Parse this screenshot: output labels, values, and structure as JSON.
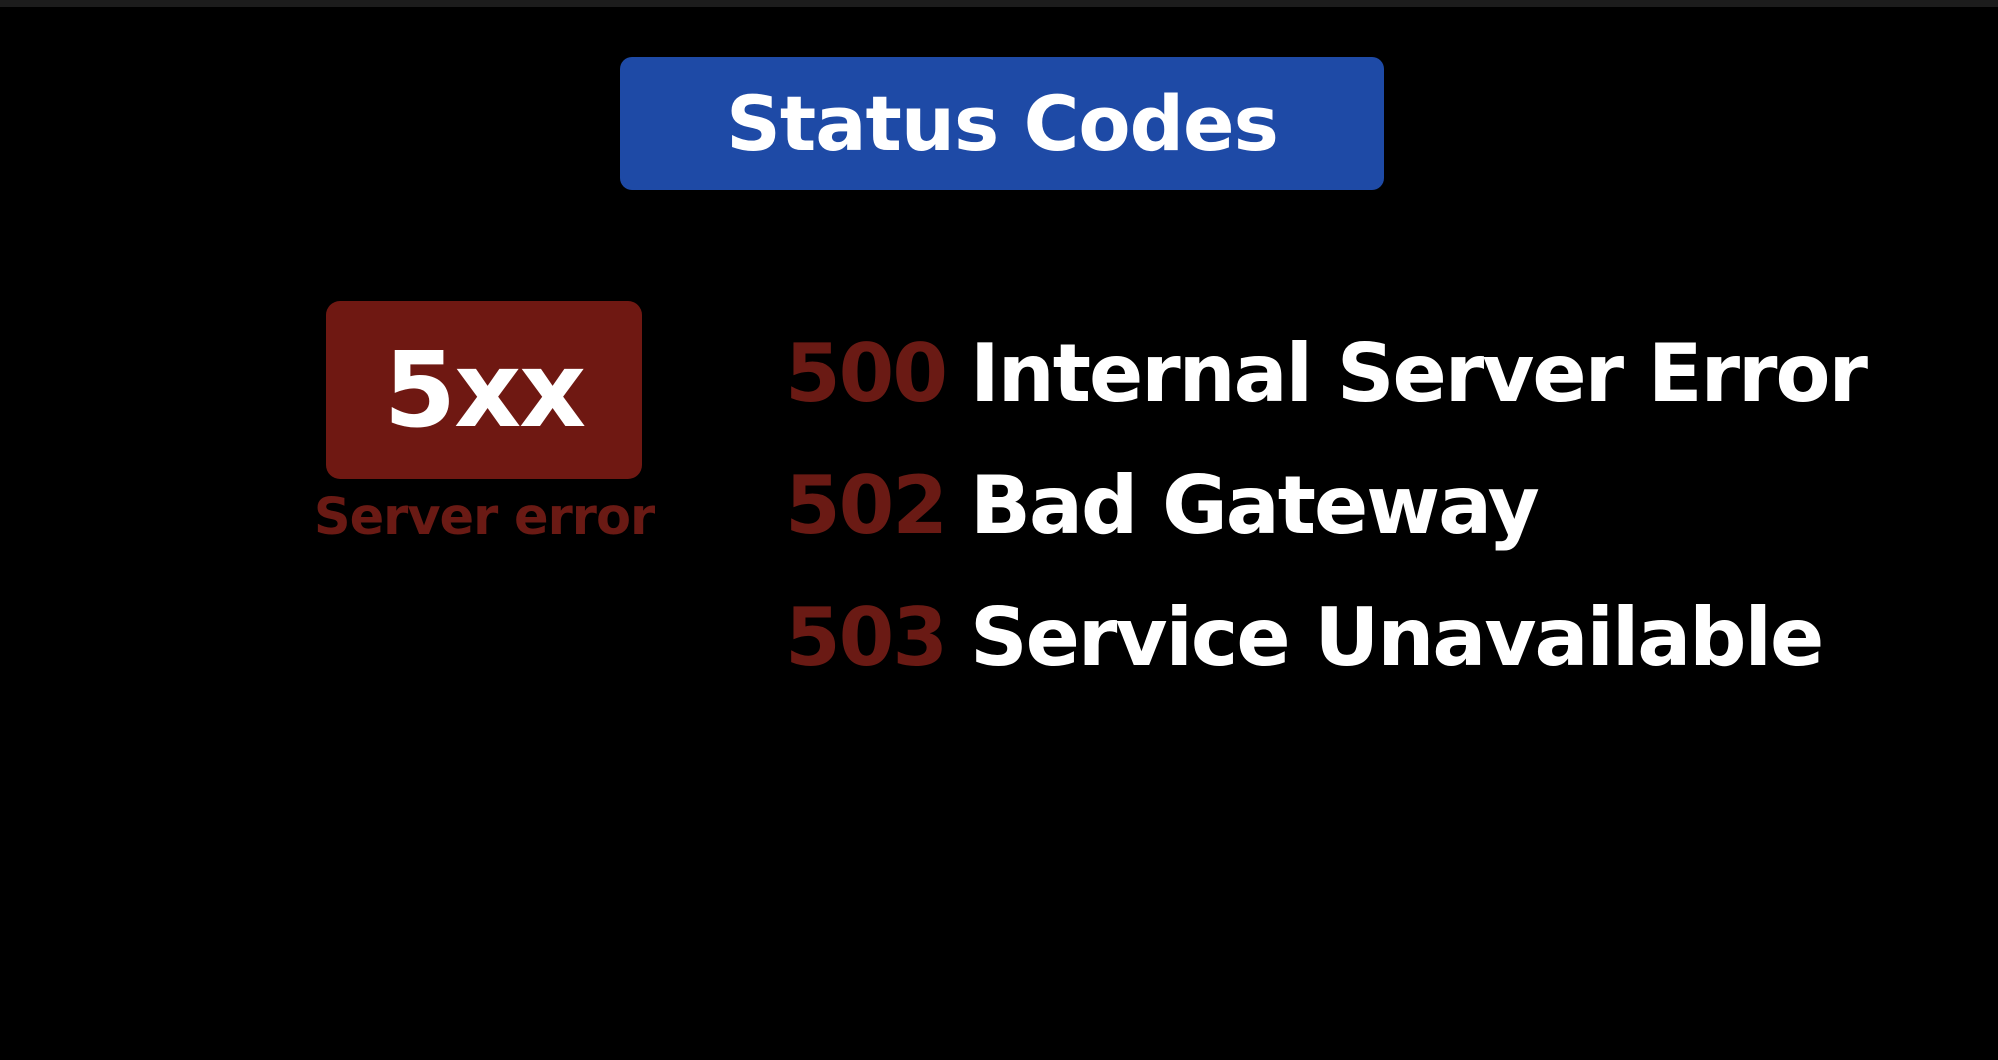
{
  "title": "Status Codes",
  "category": {
    "code": "5xx",
    "caption": "Server error"
  },
  "codes": [
    {
      "number": "500",
      "label": "Internal Server Error"
    },
    {
      "number": "502",
      "label": "Bad Gateway"
    },
    {
      "number": "503",
      "label": "Service Unavailable"
    }
  ],
  "colors": {
    "background": "#000000",
    "title_banner": "#1e4aa6",
    "category_badge": "#6f1812",
    "code_number": "#6a1a14",
    "code_label": "#ffffff"
  }
}
